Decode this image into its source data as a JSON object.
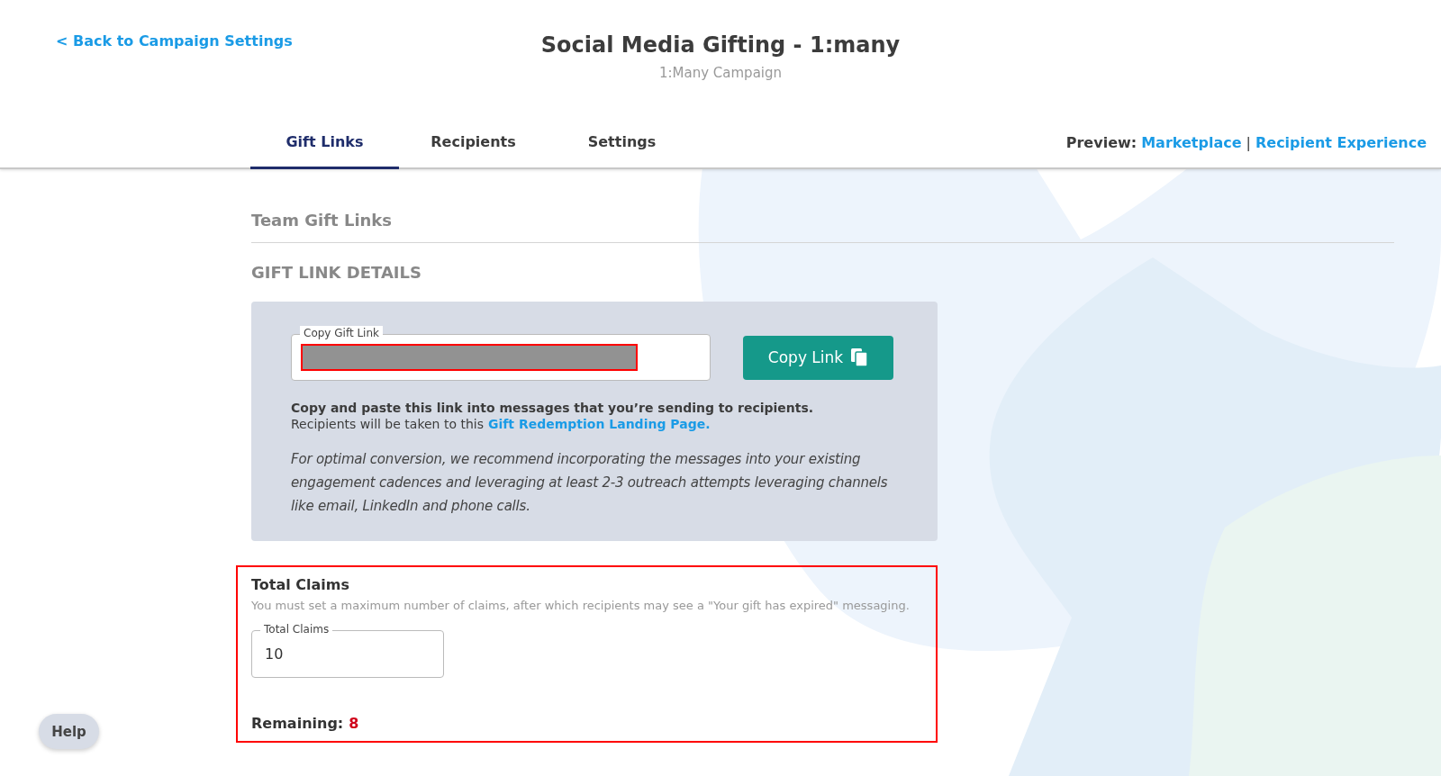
{
  "back_link": "< Back to Campaign Settings",
  "header": {
    "title": "Social Media Gifting - 1:many",
    "subtitle": "1:Many Campaign"
  },
  "tabs": [
    {
      "label": "Gift Links",
      "selected": true
    },
    {
      "label": "Recipients",
      "selected": false
    },
    {
      "label": "Settings",
      "selected": false
    }
  ],
  "preview": {
    "label": "Preview:",
    "links": [
      "Marketplace",
      "Recipient Experience"
    ],
    "separator": "|"
  },
  "section_title": "Team Gift Links",
  "details_title": "GIFT LINK DETAILS",
  "gift_link": {
    "field_label": "Copy Gift Link",
    "button": "Copy Link",
    "instruction": "Copy and paste this link into messages that you’re sending to recipients.",
    "note": "Recipients will be taken to this",
    "note_link": "Gift Redemption Landing Page.",
    "tip": "For optimal conversion, we recommend incorporating the messages into your existing engagement cadences and leveraging at least 2-3 outreach attempts leveraging channels like email, LinkedIn and phone calls."
  },
  "claims": {
    "title": "Total Claims",
    "hint": "You must set a maximum number of claims, after which recipients may see a \"Your gift has expired\" messaging.",
    "field_label": "Total Claims",
    "value": "10",
    "remaining_label": "Remaining:",
    "remaining": "8"
  },
  "help": "Help"
}
